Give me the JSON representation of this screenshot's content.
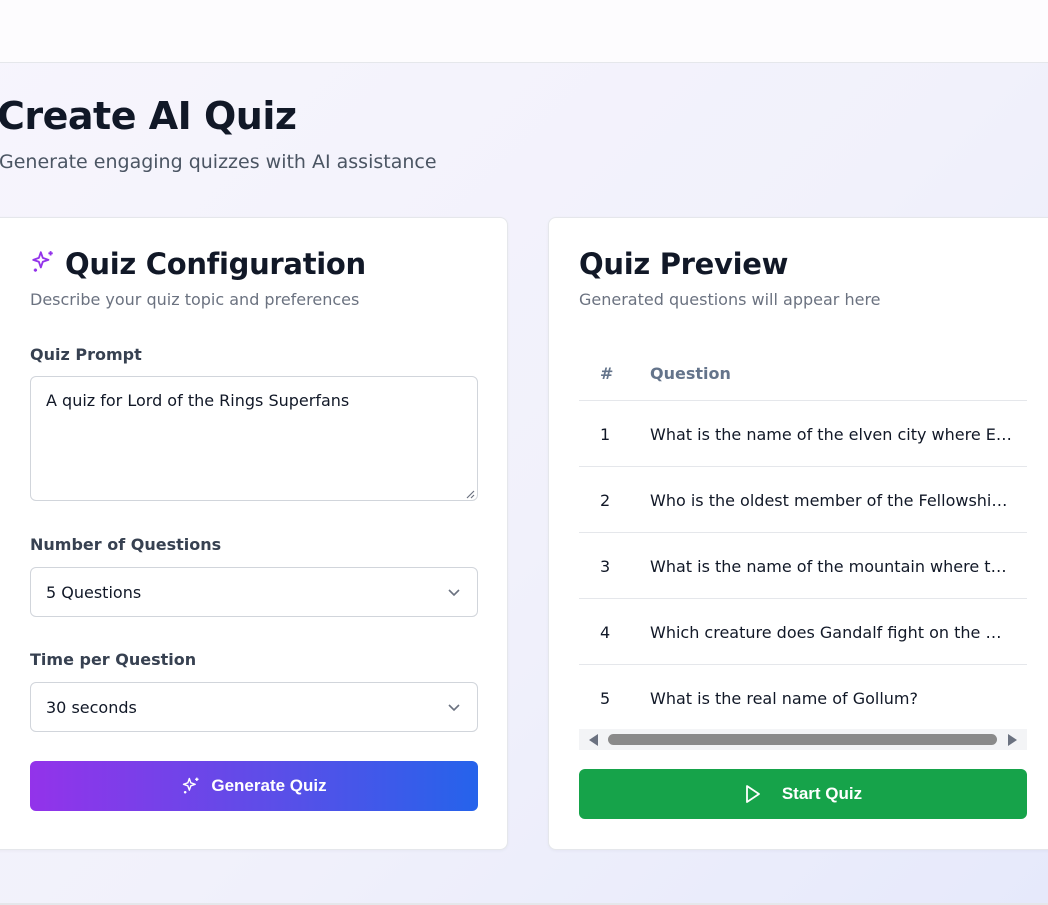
{
  "header": {
    "title": "Create AI Quiz",
    "subtitle": "Generate engaging quizzes with AI assistance"
  },
  "config": {
    "title": "Quiz Configuration",
    "description": "Describe your quiz topic and preferences",
    "icon": "sparkles-icon",
    "prompt_label": "Quiz Prompt",
    "prompt_value": "A quiz for Lord of the Rings Superfans",
    "questions_label": "Number of Questions",
    "questions_value": "5 Questions",
    "time_label": "Time per Question",
    "time_value": "30 seconds",
    "generate_label": "Generate Quiz"
  },
  "preview": {
    "title": "Quiz Preview",
    "description": "Generated questions will appear here",
    "columns": [
      "#",
      "Question"
    ],
    "rows": [
      {
        "num": "1",
        "question": "What is the name of the elven city where Elrond lives?"
      },
      {
        "num": "2",
        "question": "Who is the oldest member of the Fellowship of the Ring?"
      },
      {
        "num": "3",
        "question": "What is the name of the mountain where the One Ring was forged?"
      },
      {
        "num": "4",
        "question": "Which creature does Gandalf fight on the Bridge of Khazad-dum?"
      },
      {
        "num": "5",
        "question": "What is the real name of Gollum?"
      }
    ],
    "start_label": "Start Quiz"
  },
  "colors": {
    "accent_purple": "#9333ea",
    "accent_blue": "#2563eb",
    "start_green": "#16a34a"
  }
}
